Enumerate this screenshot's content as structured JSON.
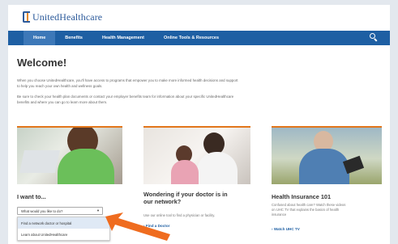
{
  "header": {
    "logo_text": "UnitedHealthcare"
  },
  "nav": {
    "items": [
      "Home",
      "Benefits",
      "Health Management",
      "Online Tools & Resources"
    ],
    "search_icon": "search-icon"
  },
  "main": {
    "welcome": "Welcome!",
    "intro_lines": [
      "When you choose UnitedHealthcare, you'll have access to programs that empower you to make more informed health decisions and support",
      "to help you reach your own health and wellness goals."
    ],
    "check_lines": [
      "Be sure to check your health plan documents or contact your employer benefits team for information about your specific UnitedHealthcare",
      "benefits and where you can go to learn more about them."
    ]
  },
  "cards": [
    {
      "title": "I want to...",
      "select_value": "What would you like to do?",
      "options": [
        "Find a network doctor or hospital",
        "Learn about UnitedHealthcare"
      ]
    },
    {
      "title_lines": [
        "Wondering if your doctor is in",
        "our network?"
      ],
      "text": "Use our online tool to find a physician or facility.",
      "link": "Find a Doctor"
    },
    {
      "title": "Health Insurance 101",
      "text_lines": [
        "Confused about health care? Watch these videos",
        "on UHC TV that explains the basics of health",
        "insurance"
      ],
      "link": "Watch UHC TV"
    }
  ],
  "colors": {
    "brand_blue": "#1e5fa3",
    "accent_orange": "#e2761b",
    "arrow_orange": "#ef6c1f"
  }
}
